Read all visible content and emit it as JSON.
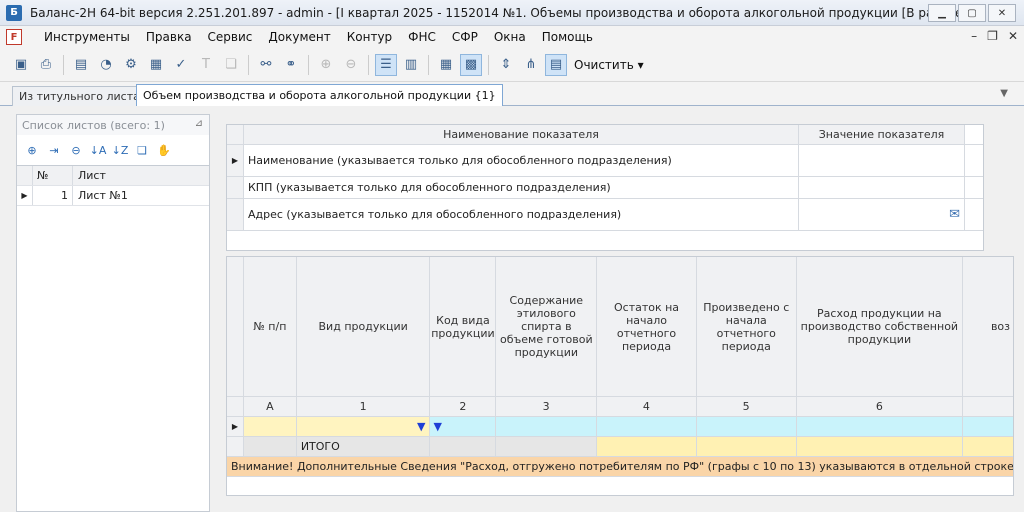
{
  "window": {
    "title": "Баланс-2Н 64-bit версия 2.251.201.897 - admin - [I квартал 2025 - 1152014 №1. Объемы производства и оборота алкогольной продукции [В работе]]"
  },
  "menu": [
    "Инструменты",
    "Правка",
    "Сервис",
    "Документ",
    "Контур",
    "ФНС",
    "СФР",
    "Окна",
    "Помощь"
  ],
  "toolbar": {
    "clear_label": "Очистить"
  },
  "tabs": [
    {
      "label": "Из титульного листа"
    },
    {
      "label": "Объем производства и оборота алкогольной продукции {1}"
    }
  ],
  "sheets_panel": {
    "title": "Список листов (всего: 1)",
    "col_num": "№",
    "col_sheet": "Лист",
    "rows": [
      {
        "num": "1",
        "sheet": "Лист №1"
      }
    ]
  },
  "indicators": {
    "col_name": "Наименование показателя",
    "col_value": "Значение показателя",
    "rows": [
      {
        "name": "Наименование (указывается только для обособленного подразделения)",
        "value": ""
      },
      {
        "name": "КПП (указывается только для обособленного подразделения)",
        "value": ""
      },
      {
        "name": "Адрес (указывается только для обособленного подразделения)",
        "value": ""
      }
    ]
  },
  "main_table": {
    "headers": [
      "№ п/п",
      "Вид продукции",
      "Код вида продукции",
      "Содержание этилового спирта в объеме готовой продукции",
      "Остаток на начало отчетного периода",
      "Произведено с начала отчетного периода",
      "Расход продукции на производство собственной продукции",
      "воз"
    ],
    "col_numbers": [
      "А",
      "1",
      "2",
      "3",
      "4",
      "5",
      "6",
      ""
    ],
    "total_label": "ИТОГО",
    "warning": "Внимание! Дополнительные Сведения \"Расход, отгружено потребителям по РФ\" (графы с 10 по 13) указываются в отдельной строке, остальные гр"
  }
}
